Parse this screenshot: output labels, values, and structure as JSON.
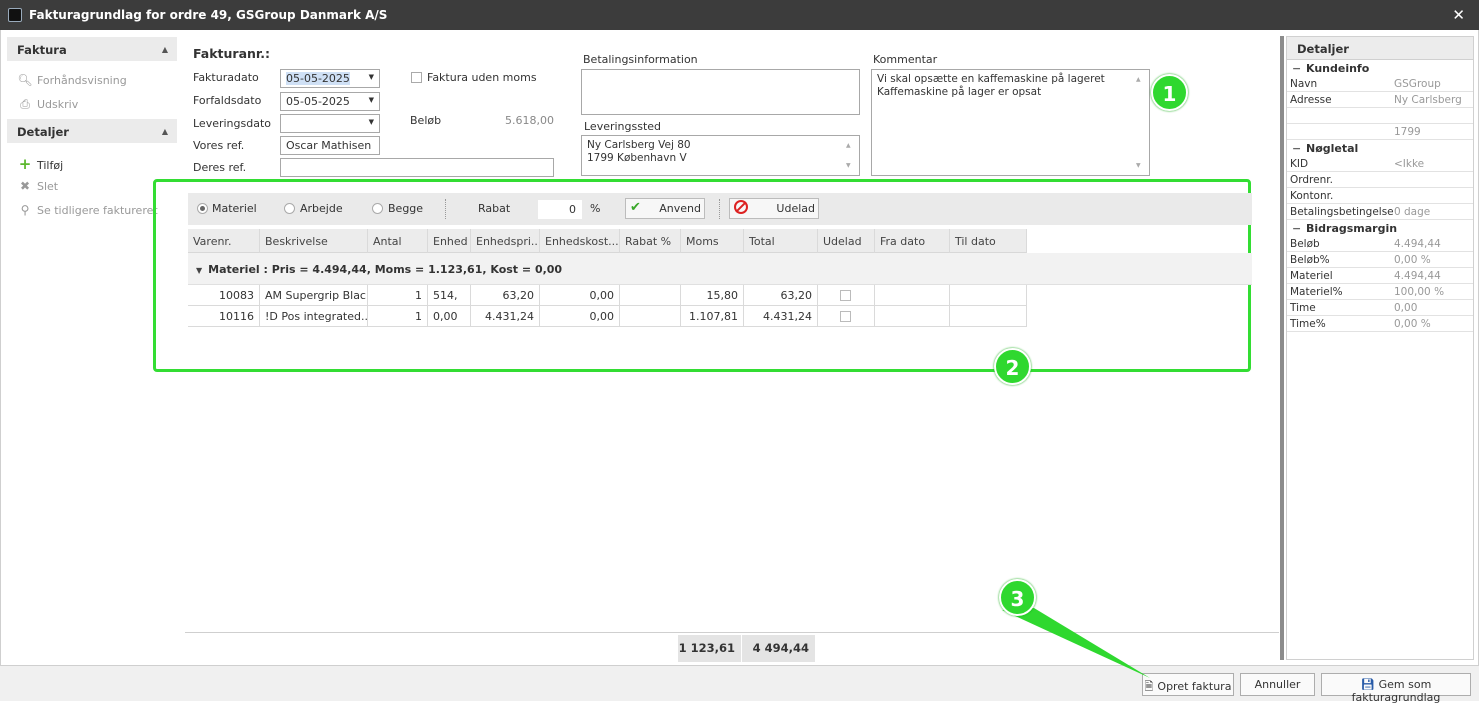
{
  "window": {
    "title": "Fakturagrundlag for ordre 49, GSGroup Danmark A/S",
    "close_glyph": "✕"
  },
  "left_panel": {
    "groups": [
      {
        "title": "Faktura",
        "items": [
          {
            "label": "Forhåndsvisning",
            "icon": "preview-icon"
          },
          {
            "label": "Udskriv",
            "icon": "printer-icon"
          }
        ]
      },
      {
        "title": "Detaljer",
        "items": [
          {
            "label": "Tilføj",
            "icon": "plus-icon"
          },
          {
            "label": "Slet",
            "icon": "x-icon"
          },
          {
            "label": "Se tidligere faktureret",
            "icon": "magnifier-icon"
          }
        ]
      }
    ]
  },
  "form": {
    "fakturanr_label": "Fakturanr.:",
    "fakturadato_label": "Fakturadato",
    "fakturadato_value": "05-05-2025",
    "forfaldsdato_label": "Forfaldsdato",
    "forfaldsdato_value": "05-05-2025",
    "leveringsdato_label": "Leveringsdato",
    "leveringsdato_value": "",
    "vores_ref_label": "Vores ref.",
    "vores_ref_value": "Oscar Mathisen",
    "deres_ref_label": "Deres ref.",
    "deres_ref_value": "",
    "uden_moms_label": "Faktura uden moms",
    "belob_label": "Beløb",
    "belob_value": "5.618,00",
    "betalingsinfo_label": "Betalingsinformation",
    "betalingsinfo_value": "",
    "leveringssted_label": "Leveringssted",
    "leveringssted_line1": "Ny Carlsberg Vej 80",
    "leveringssted_line2": "1799 København V",
    "kommentar_label": "Kommentar",
    "kommentar_line1": "Vi skal opsætte en kaffemaskine på lageret",
    "kommentar_line2": "Kaffemaskine på lager er opsat"
  },
  "toolbar": {
    "radio_materiel": "Materiel",
    "radio_arbejde": "Arbejde",
    "radio_begge": "Begge",
    "rabat_label": "Rabat",
    "rabat_value": "0",
    "rabat_unit": "%",
    "anvend_label": "Anvend",
    "udelad_label": "Udelad"
  },
  "grid": {
    "columns": [
      "Varenr.",
      "Beskrivelse",
      "Antal",
      "Enhed",
      "Enhedspri...",
      "Enhedskost...",
      "Rabat %",
      "Moms",
      "Total",
      "Udelad",
      "Fra dato",
      "Til dato"
    ],
    "group_label": "Materiel : Pris = 4.494,44, Moms = 1.123,61, Kost = 0,00",
    "rows": [
      {
        "varenr": "10083",
        "beskrivelse": "AM Supergrip Blac...",
        "antal": "1",
        "enhed": "514,",
        "enhedspris": "63,20",
        "enhedskost": "0,00",
        "rabat": "",
        "moms": "15,80",
        "total": "63,20",
        "fra": "",
        "til": ""
      },
      {
        "varenr": "10116",
        "beskrivelse": "!D Pos integrated...",
        "antal": "1",
        "enhed": "0,00",
        "enhedspris": "4.431,24",
        "enhedskost": "0,00",
        "rabat": "",
        "moms": "1.107,81",
        "total": "4.431,24",
        "fra": "",
        "til": ""
      }
    ],
    "footer_moms": "1 123,61",
    "footer_total": "4 494,44"
  },
  "right_panel": {
    "title": "Detaljer",
    "sections": [
      {
        "title": "Kundeinfo",
        "rows": [
          {
            "k": "Navn",
            "v": "GSGroup"
          },
          {
            "k": "Adresse",
            "v": "Ny Carlsberg"
          },
          {
            "k": "",
            "v": ""
          },
          {
            "k": "",
            "v": "1799"
          }
        ]
      },
      {
        "title": "Nøgletal",
        "rows": [
          {
            "k": "KID",
            "v": "<Ikke"
          },
          {
            "k": "Ordrenr.",
            "v": ""
          },
          {
            "k": "Kontonr.",
            "v": ""
          },
          {
            "k": "Betalingsbetingelse",
            "v": "0 dage"
          }
        ]
      },
      {
        "title": "Bidragsmargin",
        "rows": [
          {
            "k": "Beløb",
            "v": "4.494,44"
          },
          {
            "k": "Beløb%",
            "v": "0,00 %"
          },
          {
            "k": "Materiel",
            "v": "4.494,44"
          },
          {
            "k": "Materiel%",
            "v": "100,00 %"
          },
          {
            "k": "Time",
            "v": "0,00"
          },
          {
            "k": "Time%",
            "v": "0,00 %"
          }
        ]
      }
    ]
  },
  "buttons": {
    "opret": "Opret faktura",
    "annuller": "Annuller",
    "gem": "Gem som fakturagrundlag"
  },
  "callouts": [
    "1",
    "2",
    "3"
  ],
  "colors": {
    "highlight": "#33dd33",
    "titlebar": "#3c3c3c"
  }
}
